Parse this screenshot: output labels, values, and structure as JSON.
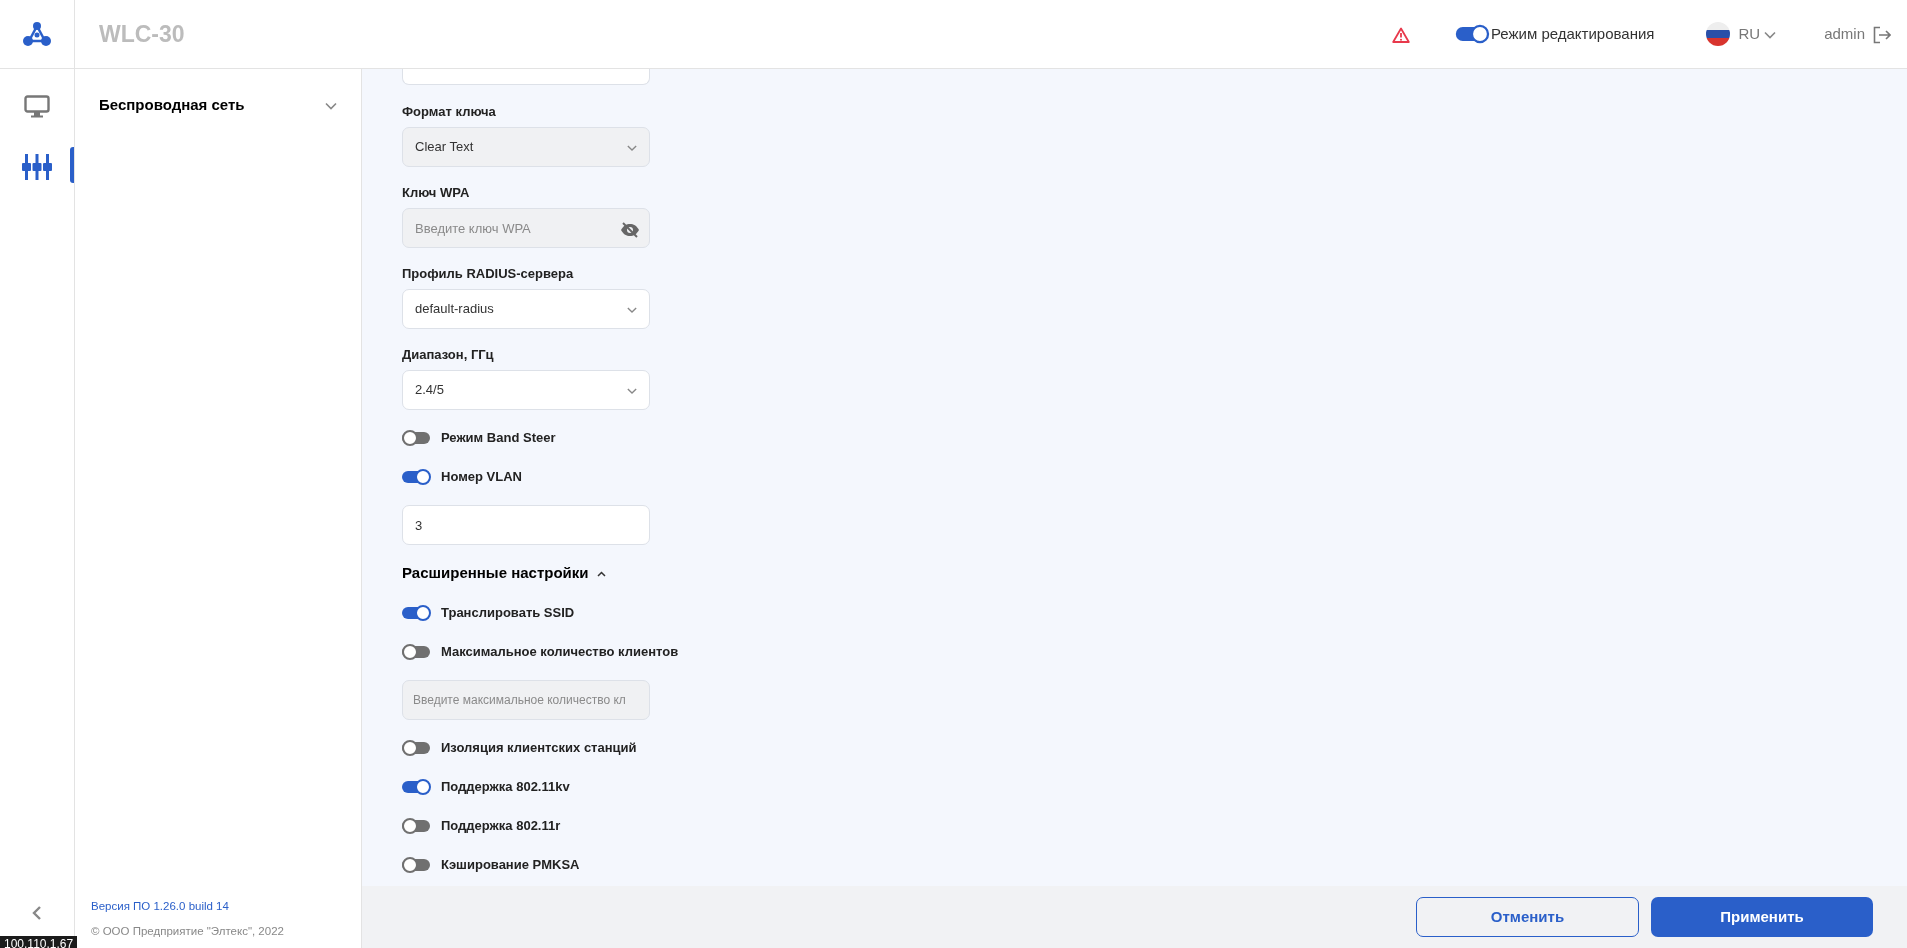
{
  "header": {
    "title": "WLC-30",
    "edit_mode": {
      "label": "Режим редактирования",
      "on": true
    },
    "language": "RU",
    "user": "admin"
  },
  "rail": {
    "items": [
      {
        "kind": "monitor",
        "selected": false
      },
      {
        "kind": "settings",
        "selected": true
      }
    ]
  },
  "sidebar": {
    "items": [
      {
        "label": "Беспроводная сеть",
        "expanded": false
      }
    ],
    "version": "Версия ПО 1.26.0 build 14",
    "copyright": "© ООО Предприятие \"Элтекс\", 2022"
  },
  "form": {
    "fields": [
      {
        "kind": "cut"
      },
      {
        "kind": "select",
        "label": "Формат ключа",
        "value": "Clear Text",
        "disabled": true
      },
      {
        "kind": "password",
        "label": "Ключ WPA",
        "placeholder": "Введите ключ WPA",
        "disabled": true
      },
      {
        "kind": "select",
        "label": "Профиль RADIUS-сервера",
        "value": "default-radius",
        "disabled": false
      },
      {
        "kind": "select",
        "label": "Диапазон, ГГц",
        "value": "2.4/5",
        "disabled": false
      },
      {
        "kind": "toggle",
        "label": "Режим Band Steer",
        "on": false
      },
      {
        "kind": "toggle",
        "label": "Номер VLAN",
        "on": true
      },
      {
        "kind": "text",
        "value": "3",
        "disabled": false
      },
      {
        "kind": "section",
        "label": "Расширенные настройки",
        "expanded": true
      },
      {
        "kind": "toggle",
        "label": "Транслировать SSID",
        "on": true
      },
      {
        "kind": "toggle",
        "label": "Максимальное количество клиентов",
        "on": false
      },
      {
        "kind": "text",
        "placeholder": "Введите максимальное количество кл",
        "disabled": true
      },
      {
        "kind": "toggle",
        "label": "Изоляция клиентских станций",
        "on": false
      },
      {
        "kind": "toggle",
        "label": "Поддержка 802.11kv",
        "on": true
      },
      {
        "kind": "toggle",
        "label": "Поддержка 802.11r",
        "on": false
      },
      {
        "kind": "toggle",
        "label": "Кэширование PMKSA",
        "on": false
      }
    ]
  },
  "buttons": [
    {
      "label": "Отменить",
      "kind": "secondary"
    },
    {
      "label": "Применить",
      "kind": "primary"
    }
  ],
  "status_url": "100.110.1.67"
}
